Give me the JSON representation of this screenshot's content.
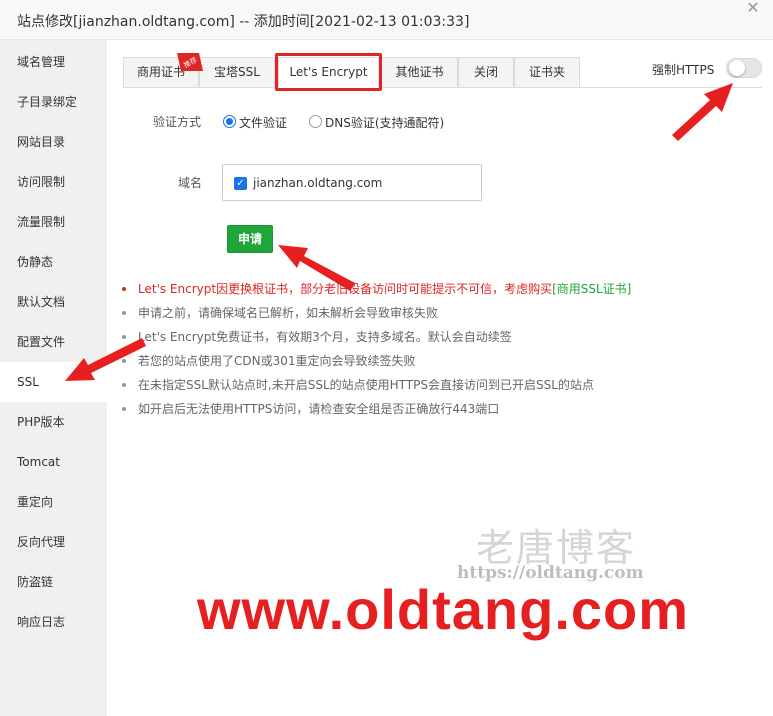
{
  "window": {
    "title": "站点修改[jianzhan.oldtang.com] -- 添加时间[2021-02-13 01:03:33]",
    "close_glyph": "✕"
  },
  "sidebar": {
    "items": [
      {
        "label": "域名管理"
      },
      {
        "label": "子目录绑定"
      },
      {
        "label": "网站目录"
      },
      {
        "label": "访问限制"
      },
      {
        "label": "流量限制"
      },
      {
        "label": "伪静态"
      },
      {
        "label": "默认文档"
      },
      {
        "label": "配置文件"
      },
      {
        "label": "SSL",
        "active": true
      },
      {
        "label": "PHP版本"
      },
      {
        "label": "Tomcat"
      },
      {
        "label": "重定向"
      },
      {
        "label": "反向代理"
      },
      {
        "label": "防盗链"
      },
      {
        "label": "响应日志"
      }
    ]
  },
  "tabs": [
    {
      "label": "商用证书",
      "badge": "推荐"
    },
    {
      "label": "宝塔SSL"
    },
    {
      "label": "Let's Encrypt",
      "active": true
    },
    {
      "label": "其他证书"
    },
    {
      "label": "关闭"
    },
    {
      "label": "证书夹"
    }
  ],
  "force_https": {
    "label": "强制HTTPS",
    "enabled": false
  },
  "verify": {
    "label": "验证方式",
    "options": [
      {
        "label": "文件验证",
        "checked": true
      },
      {
        "label": "DNS验证(支持通配符)",
        "checked": false
      }
    ]
  },
  "domain": {
    "label": "域名",
    "value": "jianzhan.oldtang.com",
    "checked": true
  },
  "apply_button": "申请",
  "tips": [
    {
      "text": "Let's Encrypt因更换根证书，部分老旧设备访问时可能提示不可信，考虑购买",
      "link": "[商用SSL证书]",
      "warn": true
    },
    {
      "text": "申请之前，请确保域名已解析，如未解析会导致审核失败"
    },
    {
      "text": "Let's Encrypt免费证书，有效期3个月，支持多域名。默认会自动续签"
    },
    {
      "text": "若您的站点使用了CDN或301重定向会导致续签失败"
    },
    {
      "text": "在未指定SSL默认站点时,未开启SSL的站点使用HTTPS会直接访问到已开启SSL的站点"
    },
    {
      "text": "如开启后无法使用HTTPS访问，请检查安全组是否正确放行443端口"
    }
  ],
  "watermark": {
    "cn": "老唐博客",
    "url": "https://oldtang.com",
    "big": "www.oldtang.com"
  },
  "colors": {
    "accent_green": "#20a53a",
    "highlight_red": "#e02525",
    "radio_blue": "#1a73e8"
  }
}
